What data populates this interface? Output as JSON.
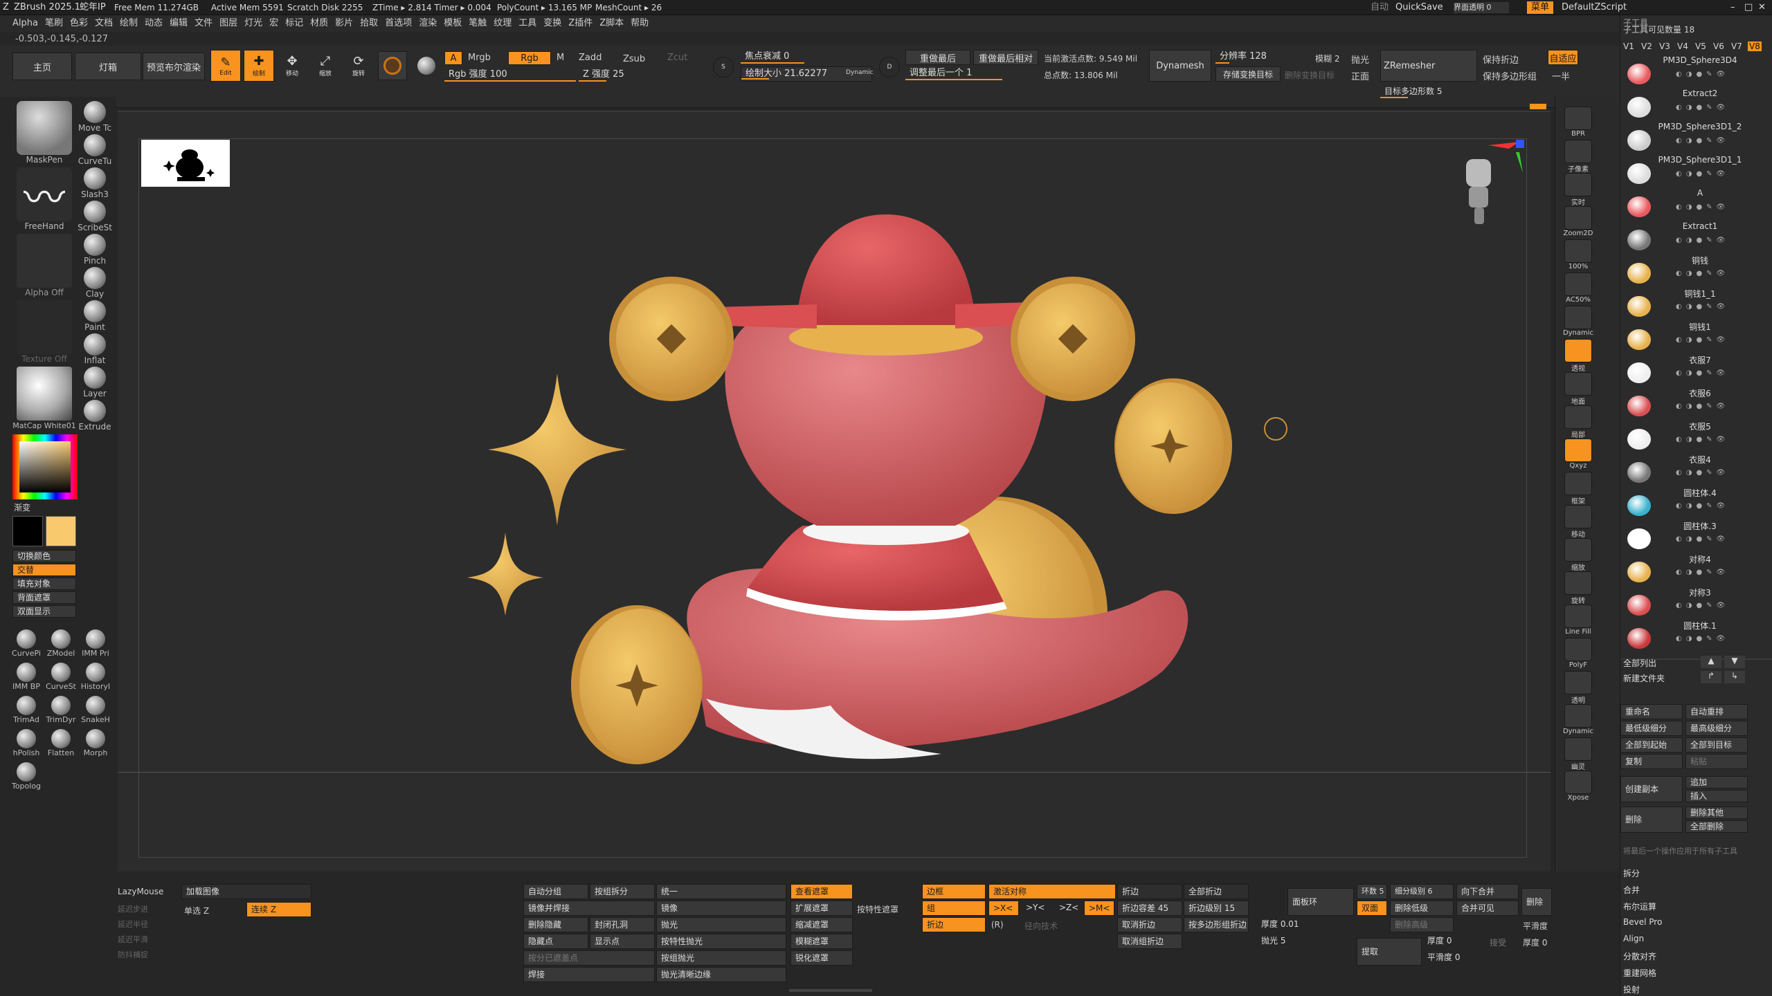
{
  "titlebar": {
    "app": "ZBrush 2025.1",
    "project": "蛇年IP",
    "stats": [
      "Free Mem 11.274GB",
      "Active Mem 5591",
      "Scratch Disk 2255",
      "ZTime ▸ 2.814 Timer ▸ 0.004",
      "PolyCount ▸ 13.165 MP",
      "MeshCount ▸ 26"
    ],
    "auto": "自动",
    "quicksave": "QuickSave",
    "transparency": "界面透明 0",
    "menu": "菜单",
    "script": "DefaultZScript"
  },
  "menu": [
    "Alpha",
    "笔刷",
    "色彩",
    "文档",
    "绘制",
    "动态",
    "编辑",
    "文件",
    "图层",
    "灯光",
    "宏",
    "标记",
    "材质",
    "影片",
    "拾取",
    "首选项",
    "渲染",
    "模板",
    "笔触",
    "纹理",
    "工具",
    "变换",
    "Z插件",
    "Z脚本",
    "帮助"
  ],
  "coords": "-0.503,-0.145,-0.127",
  "shelf": {
    "home": "主页",
    "lightbox": "灯箱",
    "bpr": "预览布尔渲染",
    "edit": "Edit",
    "draw": "绘制",
    "move": "移动",
    "scale": "缩放",
    "rotate": "旋转",
    "a": "A",
    "mrgb": "Mrgb",
    "rgb": "Rgb",
    "m": "M",
    "zadd": "Zadd",
    "zsub": "Zsub",
    "zcut": "Zcut",
    "rgb_intensity": "Rgb 强度 100",
    "z_intensity": "Z 强度 25",
    "focal": "焦点衰减 0",
    "draw_size": "绘制大小 21.62277",
    "dynamic": "Dynamic",
    "s": "S",
    "d": "D",
    "replay_last": "重做最后",
    "replay_rel": "重做最后相对",
    "adjust_last": "调整最后一个 1",
    "active_points": "当前激活点数: 9.549 Mil",
    "total_points": "总点数: 13.806 Mil",
    "dynamesh": "Dynamesh",
    "resolution": "分辨率 128",
    "blur": "模糊 2",
    "polish": "抛光",
    "store_morph": "存储变换目标",
    "del_morph": "删除变换目标",
    "front": "正面",
    "zremesher": "ZRemesher",
    "keep_creases": "保持折边",
    "keep_groups": "保持多边形组",
    "adaptive": "自适应",
    "half": "一半",
    "target_poly": "目标多边形数 5"
  },
  "left": {
    "brushes": [
      {
        "name": "MaskPen"
      },
      {
        "name": "Move Tc"
      },
      {
        "name": "CurveTu"
      },
      {
        "name": "FreeHand"
      },
      {
        "name": "Slash3"
      },
      {
        "name": "ScribeSt"
      },
      {
        "name": "Alpha Off"
      },
      {
        "name": "Pinch"
      },
      {
        "name": "Clay"
      },
      {
        "name": "Texture Off"
      },
      {
        "name": "Paint"
      },
      {
        "name": "Inflat"
      },
      {
        "name": "MatCap White01"
      },
      {
        "name": "Layer"
      },
      {
        "name": "Extrude"
      }
    ],
    "gradient": "渐变",
    "switch_color": "切换颜色",
    "alternate": "交替",
    "fill_object": "填充对象",
    "backface_mask": "背面遮罩",
    "double_sided": "双面显示",
    "tools": [
      "CurvePi",
      "ZModel",
      "IMM Pri",
      "IMM BP",
      "CurveSt",
      "HistoryI",
      "TrimAd",
      "TrimDyr",
      "SnakeH",
      "hPolish",
      "Flatten",
      "Morph",
      "Topolog"
    ]
  },
  "rightdock": [
    "BPR",
    "子像素",
    "实时",
    "Zoom2D",
    "100%",
    "AC50%",
    "Dynamic",
    "透视",
    "地面",
    "局部",
    "Qxyz",
    "框架",
    "移动",
    "缩放",
    "旋转",
    "Line Fill",
    "PolyF",
    "透明",
    "Dynamic",
    "幽灵",
    "Xpose"
  ],
  "subtools": {
    "header": "子工具",
    "count_label": "子工具可见数量 18",
    "versions": [
      "V1",
      "V2",
      "V3",
      "V4",
      "V5",
      "V6",
      "V7",
      "V8"
    ],
    "items": [
      "PM3D_Sphere3D4",
      "Extract2",
      "PM3D_Sphere3D1_2",
      "PM3D_Sphere3D1_1",
      "A",
      "Extract1",
      "铜钱",
      "铜钱1_1",
      "铜钱1",
      "衣服7",
      "衣服6",
      "衣服5",
      "衣服4",
      "圆柱体.4",
      "圆柱体.3",
      "对称4",
      "对称3",
      "圆柱体.1"
    ],
    "list_all": "全部列出",
    "new_folder": "新建文件夹",
    "rename": "重命名",
    "auto_reorder": "自动重排",
    "lowest_sub": "最低级细分",
    "highest_sub": "最高级细分",
    "all_low": "全部到起始",
    "all_high": "全部到目标",
    "copy": "复制",
    "paste": "粘贴",
    "create_copy": "创建副本",
    "append": "追加",
    "insert": "插入",
    "delete": "删除",
    "del_other": "删除其他",
    "del_all": "全部删除",
    "apply_hint": "将最后一个操作应用于所有子工具",
    "sections": [
      "拆分",
      "合并",
      "布尔运算",
      "Bevel Pro",
      "Align",
      "分散对齐",
      "重建网格",
      "投射"
    ]
  },
  "bottom": {
    "lazymouse": "LazyMouse",
    "load_image": "加载图像",
    "lazy_step": "延迟步进",
    "lazy_radius": "延迟半径",
    "lazy_smooth": "延迟平滑",
    "lazy_snap": "防抖捕捉",
    "single_z": "单选 Z",
    "continuous_z": "连续 Z",
    "auto_groups": "自动分组",
    "split_groups": "按组拆分",
    "unify": "统一",
    "mirror_weld": "镜像并焊接",
    "close_holes": "封闭孔洞",
    "mirror": "镜像",
    "del_hidden": "删除隐藏",
    "polish": "抛光",
    "hide_pts": "隐藏点",
    "show_pts": "显示点",
    "feature_polish": "按特性抛光",
    "group_polish": "按组抛光",
    "merge_groups": "按分已遮盖点",
    "crisp_polish": "抛光清晰边缘",
    "weld": "焊接",
    "view_mask": "查看遮罩",
    "grow_mask": "扩展遮罩",
    "shrink_mask": "缩减遮罩",
    "blur_mask": "模糊遮罩",
    "sharpen_mask": "锐化遮罩",
    "feature_mask": "按特性遮罩",
    "border": "边框",
    "group": "组",
    "crease": "折边",
    "activate_sym": "激活对称",
    "x_axis": ">X<",
    "y_axis": ">Y<",
    "z_axis": ">Z<",
    "m_axis": ">M<",
    "r": "(R)",
    "radial": "径向技术",
    "crease_btn": "折边",
    "crease_all": "全部折边",
    "crease_tol": "折边容差 45",
    "crease_level": "折边级别 15",
    "uncrease": "取消折边",
    "crease_pg": "按多边形组折边",
    "uncrease_all": "取消组折边",
    "panel_loops": "面板环",
    "loops": "环数 5",
    "subdiv": "细分级别 6",
    "merge_down": "向下合并",
    "double": "双面",
    "del_lower": "删除低级",
    "del_higher": "删除高级",
    "merge_visible": "合并可见",
    "delete": "删除",
    "thickness": "厚度 0.01",
    "polish_val": "抛光 5",
    "extract": "提取",
    "thickness2": "厚度 0",
    "accept": "接受",
    "smooth": "平滑度",
    "smooth_val": "平滑度 0",
    "thickness3": "厚度 0"
  },
  "colors": {
    "accent": "#f7931e",
    "secondary": "#f9c96e",
    "model_red": "#d94f52",
    "coin_gold": "#e7b24d"
  }
}
